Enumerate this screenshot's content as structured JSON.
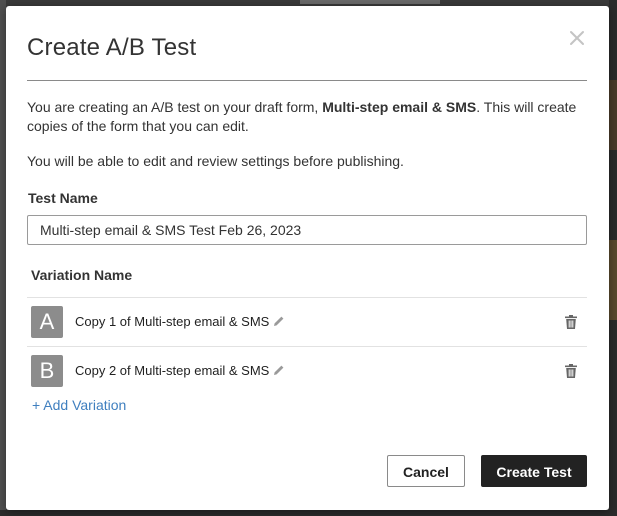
{
  "modal": {
    "title": "Create A/B Test",
    "intro_prefix": "You are creating an A/B test on your draft form, ",
    "form_name": "Multi-step email & SMS",
    "intro_suffix": ". This will create copies of the form that you can edit.",
    "review_note": "You will be able to edit and review settings before publishing."
  },
  "test_name": {
    "label": "Test Name",
    "value": "Multi-step email & SMS Test Feb 26, 2023"
  },
  "variations": {
    "label": "Variation Name",
    "items": [
      {
        "letter": "A",
        "name": "Copy 1 of Multi-step email & SMS"
      },
      {
        "letter": "B",
        "name": "Copy 2 of Multi-step email & SMS"
      }
    ],
    "add_label": "+ Add Variation"
  },
  "footer": {
    "cancel_label": "Cancel",
    "create_label": "Create Test"
  },
  "icons": {
    "close": "close-icon",
    "edit": "pencil-icon",
    "delete": "trash-icon"
  },
  "colors": {
    "primary_button": "#222222",
    "link": "#3f7fbf",
    "avatar": "#8c8c8c"
  }
}
